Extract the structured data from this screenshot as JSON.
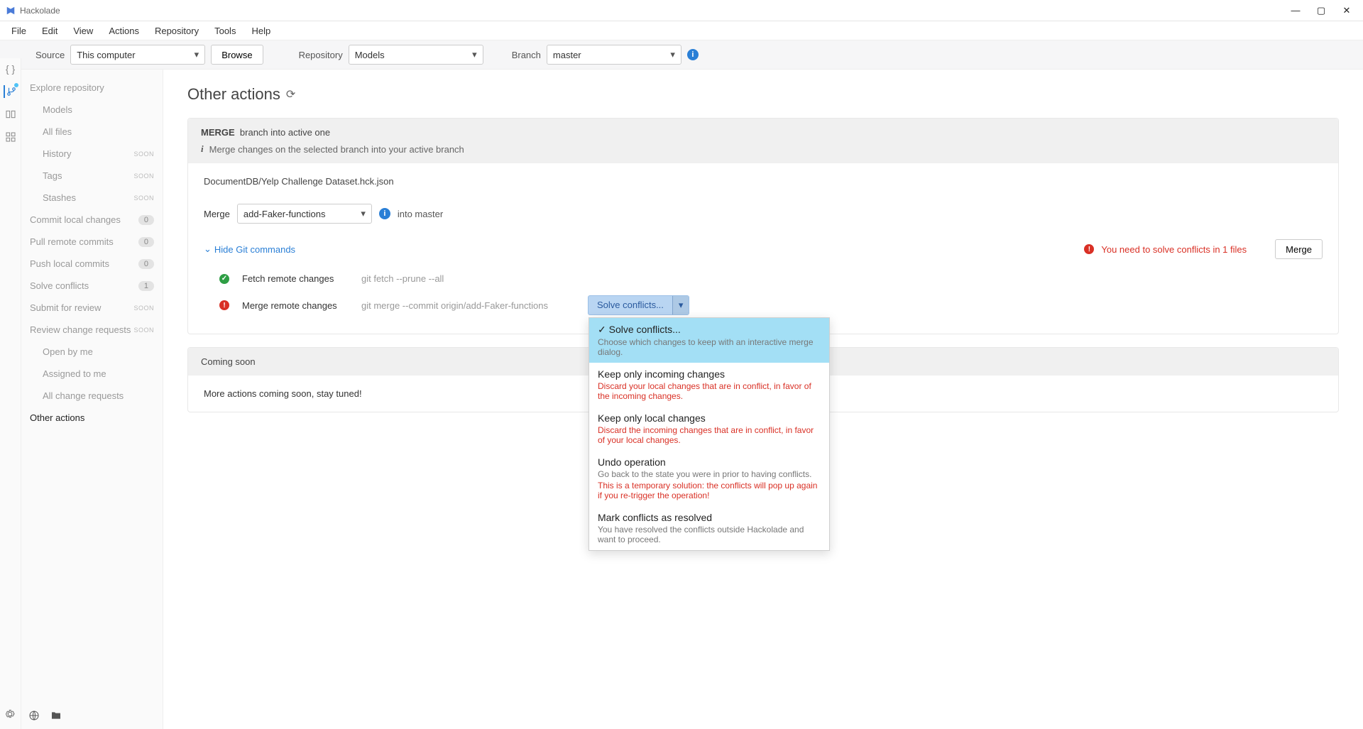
{
  "app": {
    "name": "Hackolade"
  },
  "menu": [
    "File",
    "Edit",
    "View",
    "Actions",
    "Repository",
    "Tools",
    "Help"
  ],
  "toolbar": {
    "source_label": "Source",
    "source_value": "This computer",
    "browse": "Browse",
    "repository_label": "Repository",
    "repository_value": "Models",
    "branch_label": "Branch",
    "branch_value": "master"
  },
  "sidebar": {
    "explore": "Explore repository",
    "models": "Models",
    "allfiles": "All files",
    "history": "History",
    "tags": "Tags",
    "stashes": "Stashes",
    "commit": "Commit local changes",
    "commit_count": "0",
    "pull": "Pull remote commits",
    "pull_count": "0",
    "push": "Push local commits",
    "push_count": "0",
    "solve": "Solve conflicts",
    "solve_count": "1",
    "submit": "Submit for review",
    "review": "Review change requests",
    "open_by_me": "Open by me",
    "assigned": "Assigned to me",
    "allcr": "All change requests",
    "other": "Other actions",
    "soon": "SOON"
  },
  "page": {
    "title": "Other actions",
    "merge_card_title_bold": "MERGE",
    "merge_card_title_rest": "branch into active one",
    "merge_card_desc": "Merge changes on the selected branch into your active branch",
    "file": "DocumentDB/Yelp Challenge Dataset.hck.json",
    "merge_label": "Merge",
    "merge_branch": "add-Faker-functions",
    "into_text": "into master",
    "hide_git": "Hide Git commands",
    "conflict_msg": "You need to solve conflicts in 1 files",
    "merge_btn": "Merge",
    "cmd1_label": "Fetch remote changes",
    "cmd1_text": "git fetch --prune --all",
    "cmd2_label": "Merge remote changes",
    "cmd2_text": "git merge --commit origin/add-Faker-functions",
    "solve_btn": "Solve conflicts...",
    "coming_title": "Coming soon",
    "coming_text": "More actions coming soon, stay tuned!"
  },
  "dropdown": {
    "i1_title": "✓ Solve conflicts...",
    "i1_desc": "Choose which changes to keep with an interactive merge dialog.",
    "i2_title": "Keep only incoming changes",
    "i2_desc": "Discard your local changes that are in conflict, in favor of the incoming changes.",
    "i3_title": "Keep only local changes",
    "i3_desc": "Discard the incoming changes that are in conflict, in favor of your local changes.",
    "i4_title": "Undo operation",
    "i4_desc1": "Go back to the state you were in prior to having conflicts.",
    "i4_desc2": "This is a temporary solution: the conflicts will pop up again if you re-trigger the operation!",
    "i5_title": "Mark conflicts as resolved",
    "i5_desc": "You have resolved the conflicts outside Hackolade and want to proceed."
  }
}
